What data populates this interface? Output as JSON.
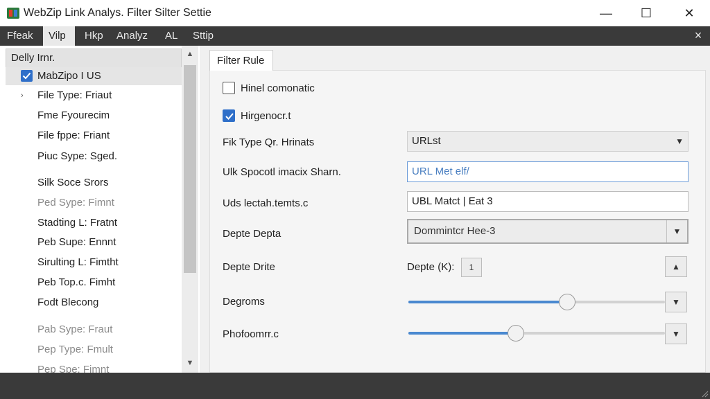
{
  "window": {
    "title": "WebZip Link Analys. Filter Silter Settie",
    "minimize": "—",
    "maximize": "☐",
    "close": "✕"
  },
  "menubar": {
    "items": [
      {
        "label": "Ffeak"
      },
      {
        "label": "Vilp"
      },
      {
        "label": "Hkp"
      },
      {
        "label": "Analyz"
      },
      {
        "label": "AL"
      },
      {
        "label": "Sttip"
      }
    ],
    "active_index": 1,
    "close": "×"
  },
  "tree": {
    "header": "Delly Irnr.",
    "items": [
      {
        "label": "MabZipo I US",
        "checked": true,
        "selected": true
      },
      {
        "label": "File Type: Friaut",
        "expander": "›"
      },
      {
        "label": "Fme Fyourecim"
      },
      {
        "label": "File fppe: Friant"
      },
      {
        "label": "Piuc Sype: Sged."
      },
      {
        "label": "Silk Soce Srors"
      },
      {
        "label": "Ped Sype: Fimnt"
      },
      {
        "label": "Stadting L: Fratnt"
      },
      {
        "label": "Peb Supe: Ennnt"
      },
      {
        "label": "Sirulting L: Fimtht"
      },
      {
        "label": "Peb Top.c. Fimht"
      },
      {
        "label": "Fodt Blecong"
      },
      {
        "label": "Pab Sype: Fraut"
      },
      {
        "label": "Pep Type: Fmult"
      },
      {
        "label": "Pep Spe: Fimnt"
      }
    ],
    "scroll_up": "▲",
    "scroll_down": "▼"
  },
  "filter": {
    "tab_label": "Filter Rule",
    "check1": {
      "label": "Hinel comonatic",
      "checked": false
    },
    "check2": {
      "label": "Hirgenocr.t",
      "checked": true
    },
    "file_type": {
      "label": "Fik Type Qr. Hrinats",
      "value": "URLst"
    },
    "url_spec": {
      "label": "Ulk Spocotl imacix Sharn.",
      "value": "URL Met elf/"
    },
    "uds": {
      "label": "Uds lectah.temts.c",
      "value": "UBL Matct | Eat 3"
    },
    "depth": {
      "label": "Depte Depta",
      "value": "Dommintcr Hee-3"
    },
    "depth_drive": {
      "label": "Depte Drite",
      "inline_label": "Depte (K):",
      "spin_value": "1",
      "button": "▲"
    },
    "degroms": {
      "label": "Degroms",
      "level": 0.62,
      "button": "▼"
    },
    "phofo": {
      "label": "Phofoomrr.c",
      "level": 0.42,
      "button": "▼"
    }
  },
  "colors": {
    "accent": "#2f6fc9",
    "menubar": "#3a3a3a",
    "slider_fill": "#4a89d0"
  }
}
